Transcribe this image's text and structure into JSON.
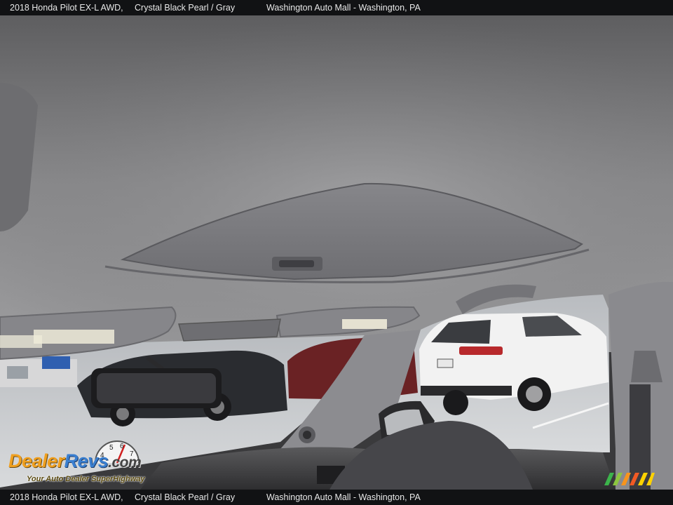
{
  "caption": {
    "vehicle": "2018 Honda Pilot EX-L AWD,",
    "colors": "Crystal Black Pearl / Gray",
    "dealer": "Washington Auto Mall - Washington, PA"
  },
  "watermark": {
    "brand_part1": "Dealer",
    "brand_part2": "Revs",
    "brand_suffix": ".com",
    "tagline": "Your Auto Dealer SuperHighway",
    "speedometer_digits": "4 5 6 7"
  },
  "colors": {
    "headliner": "#8e8e90",
    "sunshade": "#7d7d80",
    "bar_bg": "#111214",
    "logo_orange": "#f0a020",
    "logo_blue": "#3a7fd0"
  }
}
